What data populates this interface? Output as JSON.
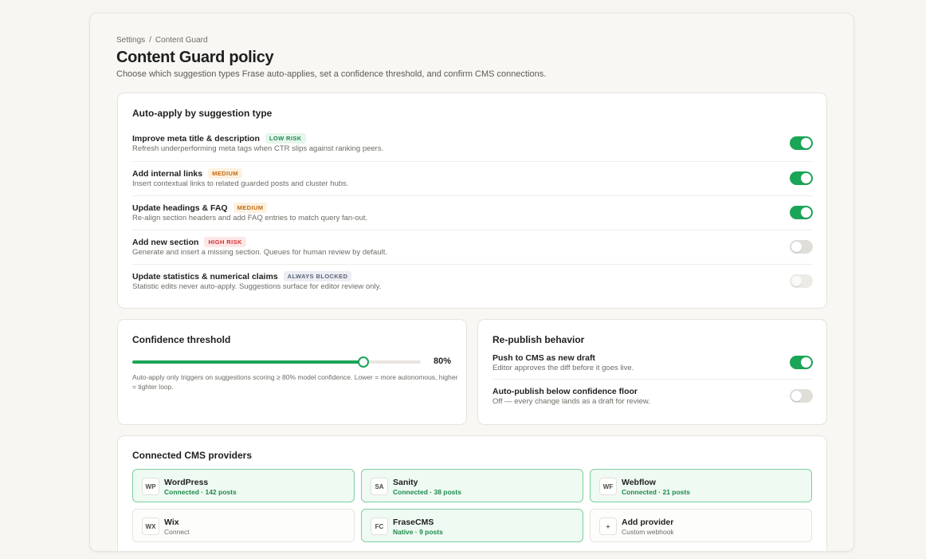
{
  "breadcrumb": {
    "root": "Settings",
    "separator": "/",
    "current": "Content Guard"
  },
  "page": {
    "title": "Content Guard policy",
    "subtitle": "Choose which suggestion types Frase auto-applies, set a confidence threshold, and confirm CMS connections."
  },
  "auto_apply": {
    "title": "Auto-apply by suggestion type",
    "rules": [
      {
        "label": "Improve meta title & description",
        "badge": "LOW RISK",
        "risk": "low",
        "desc": "Refresh underperforming meta tags when CTR slips against ranking peers.",
        "state": "on"
      },
      {
        "label": "Add internal links",
        "badge": "MEDIUM",
        "risk": "medium",
        "desc": "Insert contextual links to related guarded posts and cluster hubs.",
        "state": "on"
      },
      {
        "label": "Update headings & FAQ",
        "badge": "MEDIUM",
        "risk": "medium",
        "desc": "Re-align section headers and add FAQ entries to match query fan-out.",
        "state": "on"
      },
      {
        "label": "Add new section",
        "badge": "HIGH RISK",
        "risk": "high",
        "desc": "Generate and insert a missing section. Queues for human review by default.",
        "state": "off"
      },
      {
        "label": "Update statistics & numerical claims",
        "badge": "ALWAYS BLOCKED",
        "risk": "blocked",
        "desc": "Statistic edits never auto-apply. Suggestions surface for editor review only.",
        "state": "disabled"
      }
    ]
  },
  "confidence": {
    "title": "Confidence threshold",
    "value": 0.8,
    "value_label": "80%",
    "note": "Auto-apply only triggers on suggestions scoring ≥ 80% model confidence. Lower = more autonomous, higher = tighter loop."
  },
  "republish": {
    "title": "Re-publish behavior",
    "items": [
      {
        "label": "Push to CMS as new draft",
        "desc": "Editor approves the diff before it goes live.",
        "state": "on"
      },
      {
        "label": "Auto-publish below confidence floor",
        "desc": "Off — every change lands as a draft for review.",
        "state": "off"
      }
    ]
  },
  "cms": {
    "title": "Connected CMS providers",
    "providers": [
      {
        "mono": "WP",
        "name": "WordPress",
        "status": "Connected · 142 posts",
        "connected": true
      },
      {
        "mono": "SA",
        "name": "Sanity",
        "status": "Connected · 38 posts",
        "connected": true
      },
      {
        "mono": "WF",
        "name": "Webflow",
        "status": "Connected · 21 posts",
        "connected": true
      },
      {
        "mono": "WX",
        "name": "Wix",
        "status": "Connect",
        "connected": false
      },
      {
        "mono": "FC",
        "name": "FraseCMS",
        "status": "Native · 9 posts",
        "connected": true
      },
      {
        "mono": "+",
        "name": "Add provider",
        "status": "Custom webhook",
        "connected": false
      }
    ]
  }
}
